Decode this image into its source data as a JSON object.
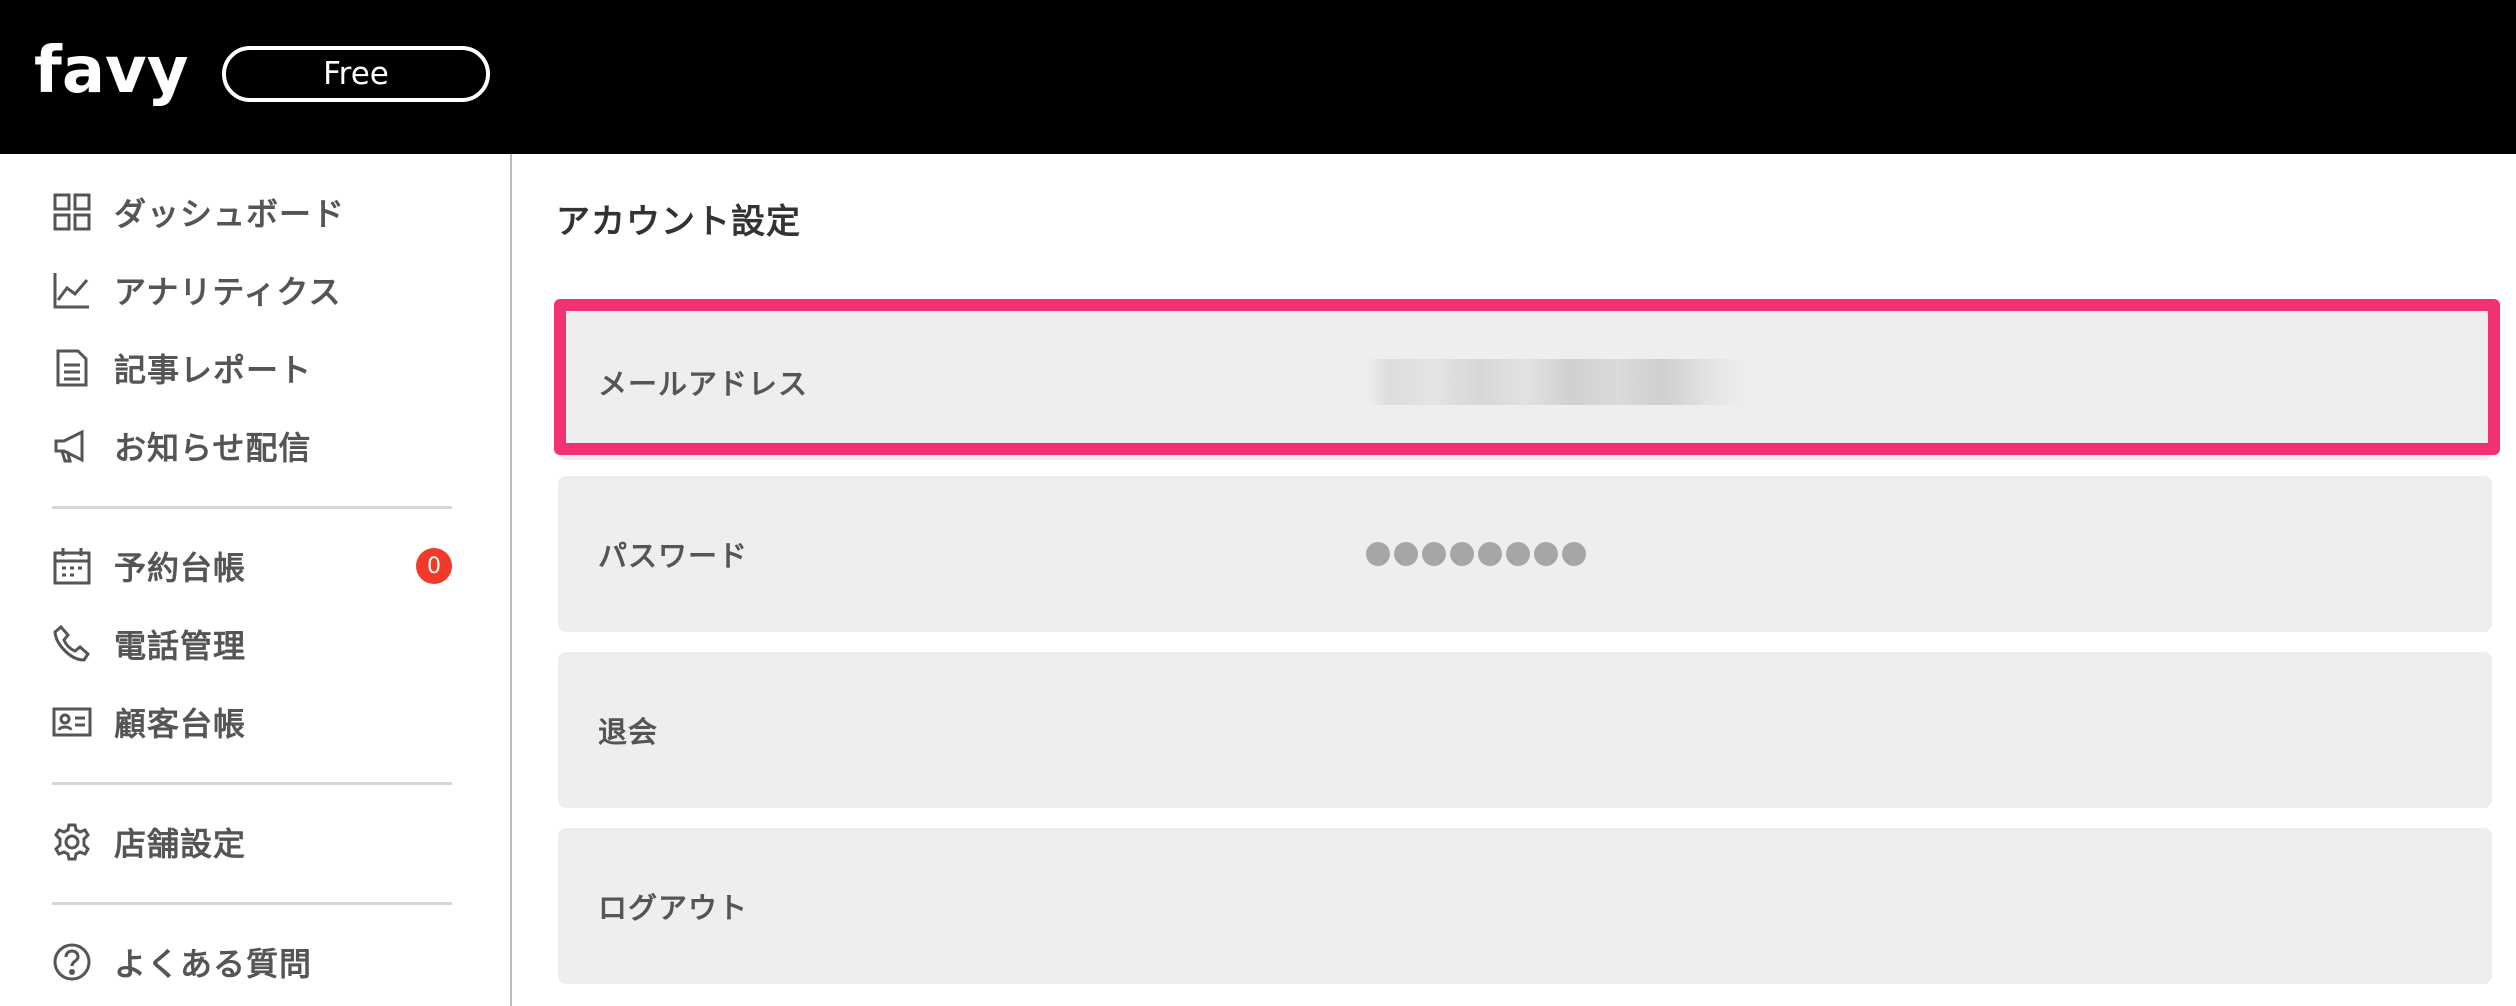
{
  "header": {
    "brand": "favy",
    "plan_label": "Free"
  },
  "sidebar": {
    "items": [
      {
        "label": "ダッシュボード",
        "icon": "grid-icon"
      },
      {
        "label": "アナリティクス",
        "icon": "chart-line-icon"
      },
      {
        "label": "記事レポート",
        "icon": "document-icon"
      },
      {
        "label": "お知らせ配信",
        "icon": "megaphone-icon"
      },
      {
        "label": "予約台帳",
        "icon": "calendar-icon",
        "badge": "0"
      },
      {
        "label": "電話管理",
        "icon": "phone-icon"
      },
      {
        "label": "顧客台帳",
        "icon": "id-card-icon"
      },
      {
        "label": "店舗設定",
        "icon": "gear-icon"
      },
      {
        "label": "よくある質問",
        "icon": "help-circle-icon"
      }
    ]
  },
  "main": {
    "title": "アカウント設定",
    "rows": [
      {
        "label": "メールアドレス",
        "value_type": "masked-email",
        "highlighted": true
      },
      {
        "label": "パスワード",
        "value_type": "password-dots",
        "dot_count": 8
      },
      {
        "label": "退会"
      },
      {
        "label": "ログアウト"
      }
    ]
  },
  "colors": {
    "header_bg": "#000000",
    "highlight": "#f03172",
    "badge": "#f23a2a",
    "row_bg": "#eeeeee"
  }
}
